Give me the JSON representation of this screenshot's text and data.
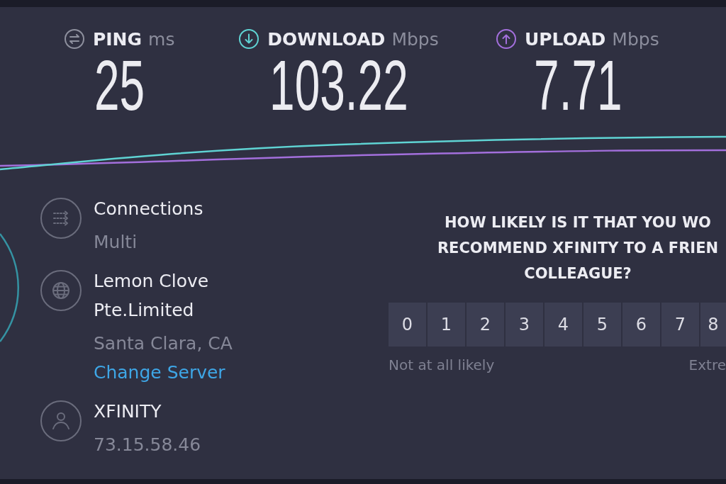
{
  "metrics": [
    {
      "kind": "ping",
      "label": "PING",
      "unit": "ms",
      "value": "25",
      "color": "#8e909e"
    },
    {
      "kind": "download",
      "label": "DOWNLOAD",
      "unit": "Mbps",
      "value": "103.22",
      "color": "#5fd3d3"
    },
    {
      "kind": "upload",
      "label": "UPLOAD",
      "unit": "Mbps",
      "value": "7.71",
      "color": "#a36fdc"
    }
  ],
  "details": [
    {
      "kind": "connections",
      "title": "Connections",
      "lines": [
        "Multi"
      ]
    },
    {
      "kind": "server",
      "title": "Lemon Clove Pte.Limited",
      "lines": [
        "Santa Clara, CA"
      ],
      "link": "Change Server"
    },
    {
      "kind": "provider",
      "title": "XFINITY",
      "lines": [
        "73.15.58.46"
      ]
    }
  ],
  "survey": {
    "question_lines": [
      "HOW LIKELY IS IT THAT YOU WO",
      "RECOMMEND XFINITY TO A FRIEN",
      "COLLEAGUE?"
    ],
    "options": [
      {
        "label": "0",
        "selected": false
      },
      {
        "label": "1",
        "selected": false
      },
      {
        "label": "2",
        "selected": false
      },
      {
        "label": "3",
        "selected": false
      },
      {
        "label": "4",
        "selected": false
      },
      {
        "label": "5",
        "selected": false
      },
      {
        "label": "6",
        "selected": false
      },
      {
        "label": "7",
        "selected": false
      },
      {
        "label": "8",
        "selected": false
      }
    ],
    "low_label": "Not at all likely",
    "high_label": "Extre"
  }
}
